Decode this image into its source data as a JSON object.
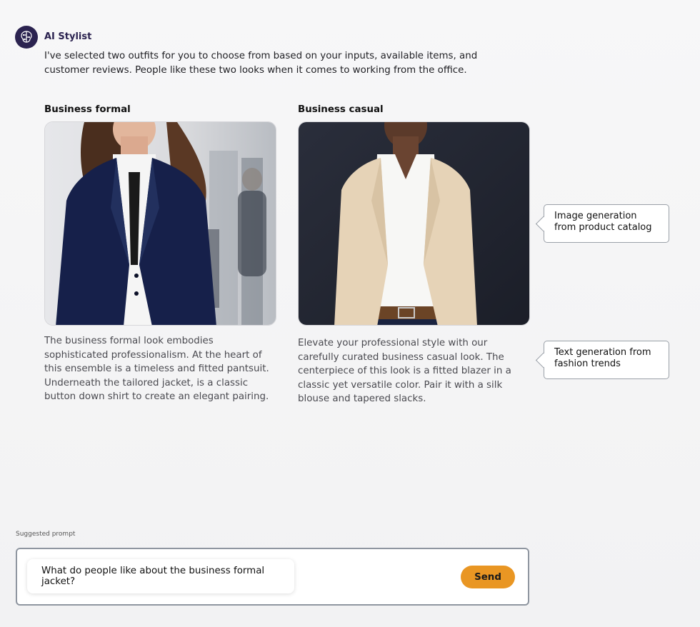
{
  "assistant": {
    "name": "AI Stylist",
    "avatar_icon": "brain-circuit-icon",
    "intro": "I've selected two outfits for you to choose from based on your inputs, available items, and customer reviews. People like these two looks when it comes to working from the office."
  },
  "outfits": [
    {
      "title": "Business formal",
      "image": "woman-in-navy-pantsuit-image",
      "description": "The business formal look embodies sophisticated professionalism. At the heart of this ensemble is a timeless and fitted pantsuit. Underneath the tailored jacket, is a classic button down shirt to create an elegant pairing."
    },
    {
      "title": "Business casual",
      "image": "woman-in-beige-blazer-image",
      "description": "Elevate your professional style with our carefully curated business casual look. The centerpiece of this look is a fitted blazer in a classic yet versatile color. Pair it with a silk blouse and tapered slacks."
    }
  ],
  "callouts": {
    "image": "Image generation from product catalog",
    "text": "Text generation from fashion trends"
  },
  "prompt": {
    "label": "Suggested prompt",
    "suggestion": "What do people like about the business formal jacket?",
    "send_label": "Send"
  },
  "colors": {
    "accent": "#e99623",
    "avatar_bg": "#2b2350",
    "navy_suit": "#16204a",
    "beige_blazer": "#e6d3b7"
  }
}
